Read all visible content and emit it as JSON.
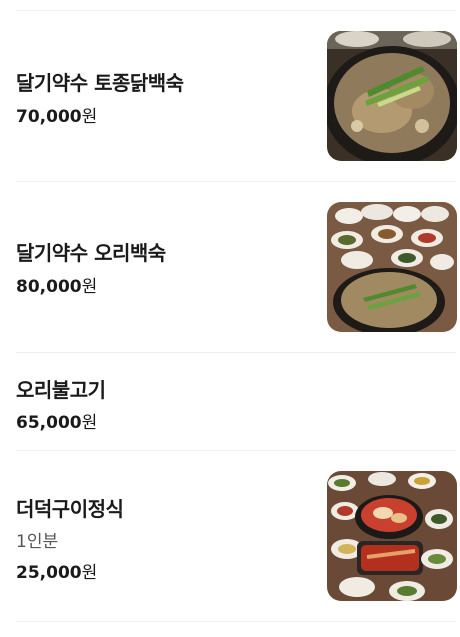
{
  "menu": {
    "items": [
      {
        "name": "달기약수 토종닭백숙",
        "price": "70,000",
        "currency": "원",
        "image_icon": "food-photo-icon"
      },
      {
        "name": "달기약수 오리백숙",
        "price": "80,000",
        "currency": "원",
        "image_icon": "food-photo-icon"
      },
      {
        "name": "오리불고기",
        "price": "65,000",
        "currency": "원"
      },
      {
        "name": "더덕구이정식",
        "description": "1인분",
        "price": "25,000",
        "currency": "원",
        "image_icon": "food-photo-icon"
      }
    ]
  }
}
